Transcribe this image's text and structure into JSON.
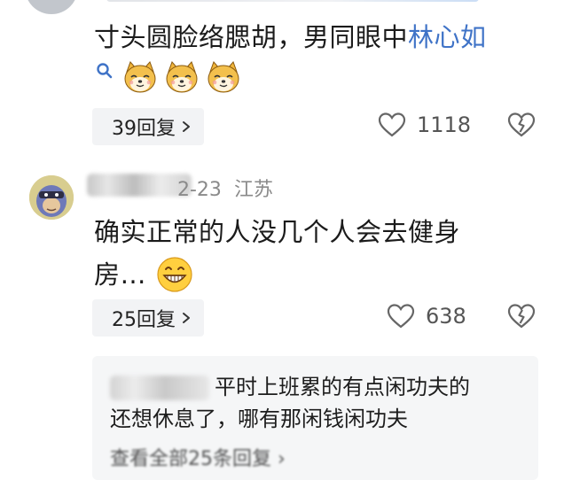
{
  "comments": [
    {
      "text_main": "寸头圆脸络腮胡，男同眼中",
      "text_link": "林心如",
      "replies_label": "39回复",
      "likes": "1118"
    },
    {
      "date": "2-23",
      "location": "江苏",
      "text_line1": "确实正常的人没几个人会去健身",
      "text_line2": "房…",
      "replies_label": "25回复",
      "likes": "638",
      "sub_reply": {
        "text_part1": "平时上班累的有点闲功夫的",
        "text_part2": "还想休息了，哪有那闲钱闲功夫",
        "view_all_label": "查看全部25条回复 ›"
      }
    }
  ],
  "icons": {
    "search": "search-icon",
    "shiba": "shiba-emoji-icon",
    "grin": "grin-emoji-icon",
    "heart": "heart-icon",
    "dislike": "broken-heart-icon",
    "chevron": "chevron-right-icon"
  },
  "colors": {
    "link": "#3f73c7",
    "pill_bg": "#f2f3f5",
    "sub_bg": "#f5f6f7"
  }
}
